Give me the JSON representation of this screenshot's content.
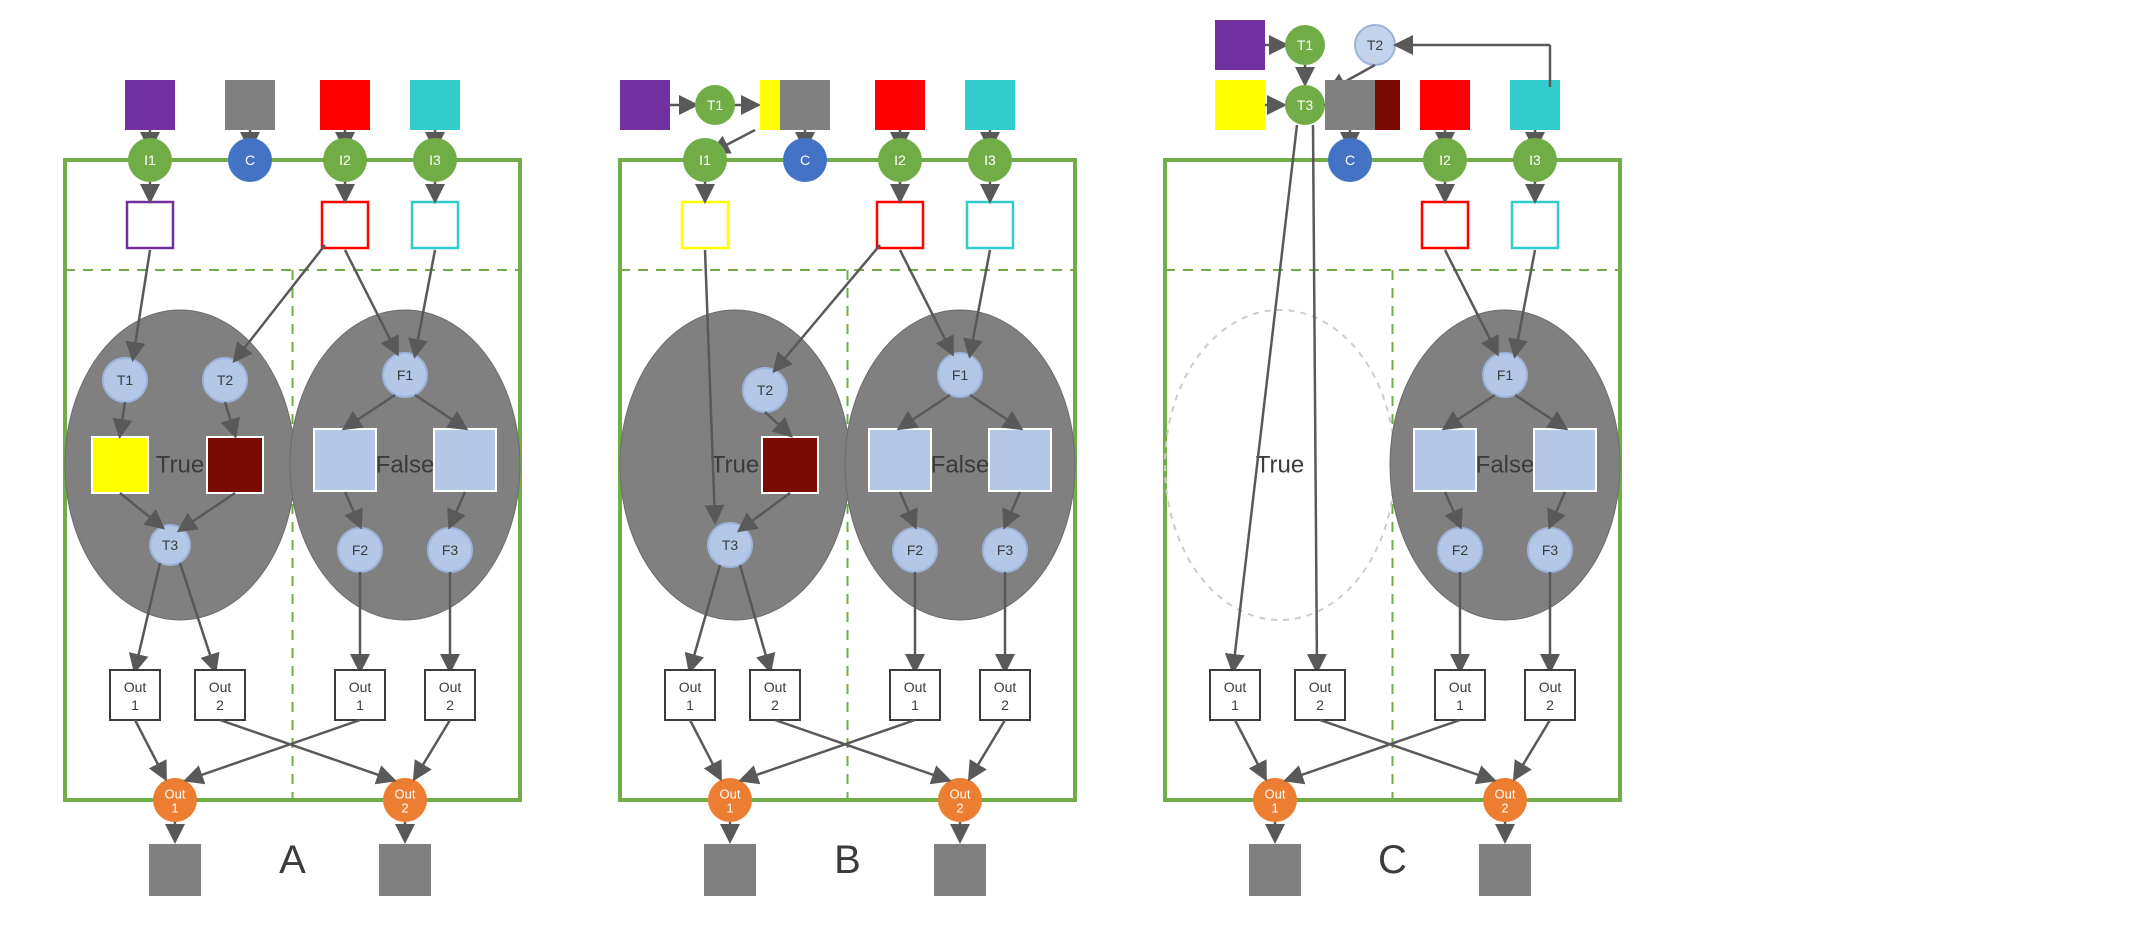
{
  "colors": {
    "green": "#70AD47",
    "blue": "#4472C4",
    "lightblue": "#B4C7E7",
    "verylightblue": "#c4d3ec",
    "orange": "#F4B183",
    "orangeFill": "#ED7D31",
    "grayFill": "#808080",
    "grayStroke": "#595959",
    "ellipse": "#808080",
    "ellipseStroke": "#6b6b6b",
    "purple": "#7030A0",
    "red": "#FF0000",
    "cyan": "#33CCCC",
    "yellow": "#FFFF00",
    "darkred": "#7B0A02"
  },
  "labels": {
    "I1": "I1",
    "I2": "I2",
    "I3": "I3",
    "C": "C",
    "T1": "T1",
    "T2": "T2",
    "T3": "T3",
    "F1": "F1",
    "F2": "F2",
    "F3": "F3",
    "True": "True",
    "False": "False",
    "Out1a": "Out",
    "Out1b": "1",
    "Out2a": "Out",
    "Out2b": "2",
    "panelA": "A",
    "panelB": "B",
    "panelC": "C"
  }
}
